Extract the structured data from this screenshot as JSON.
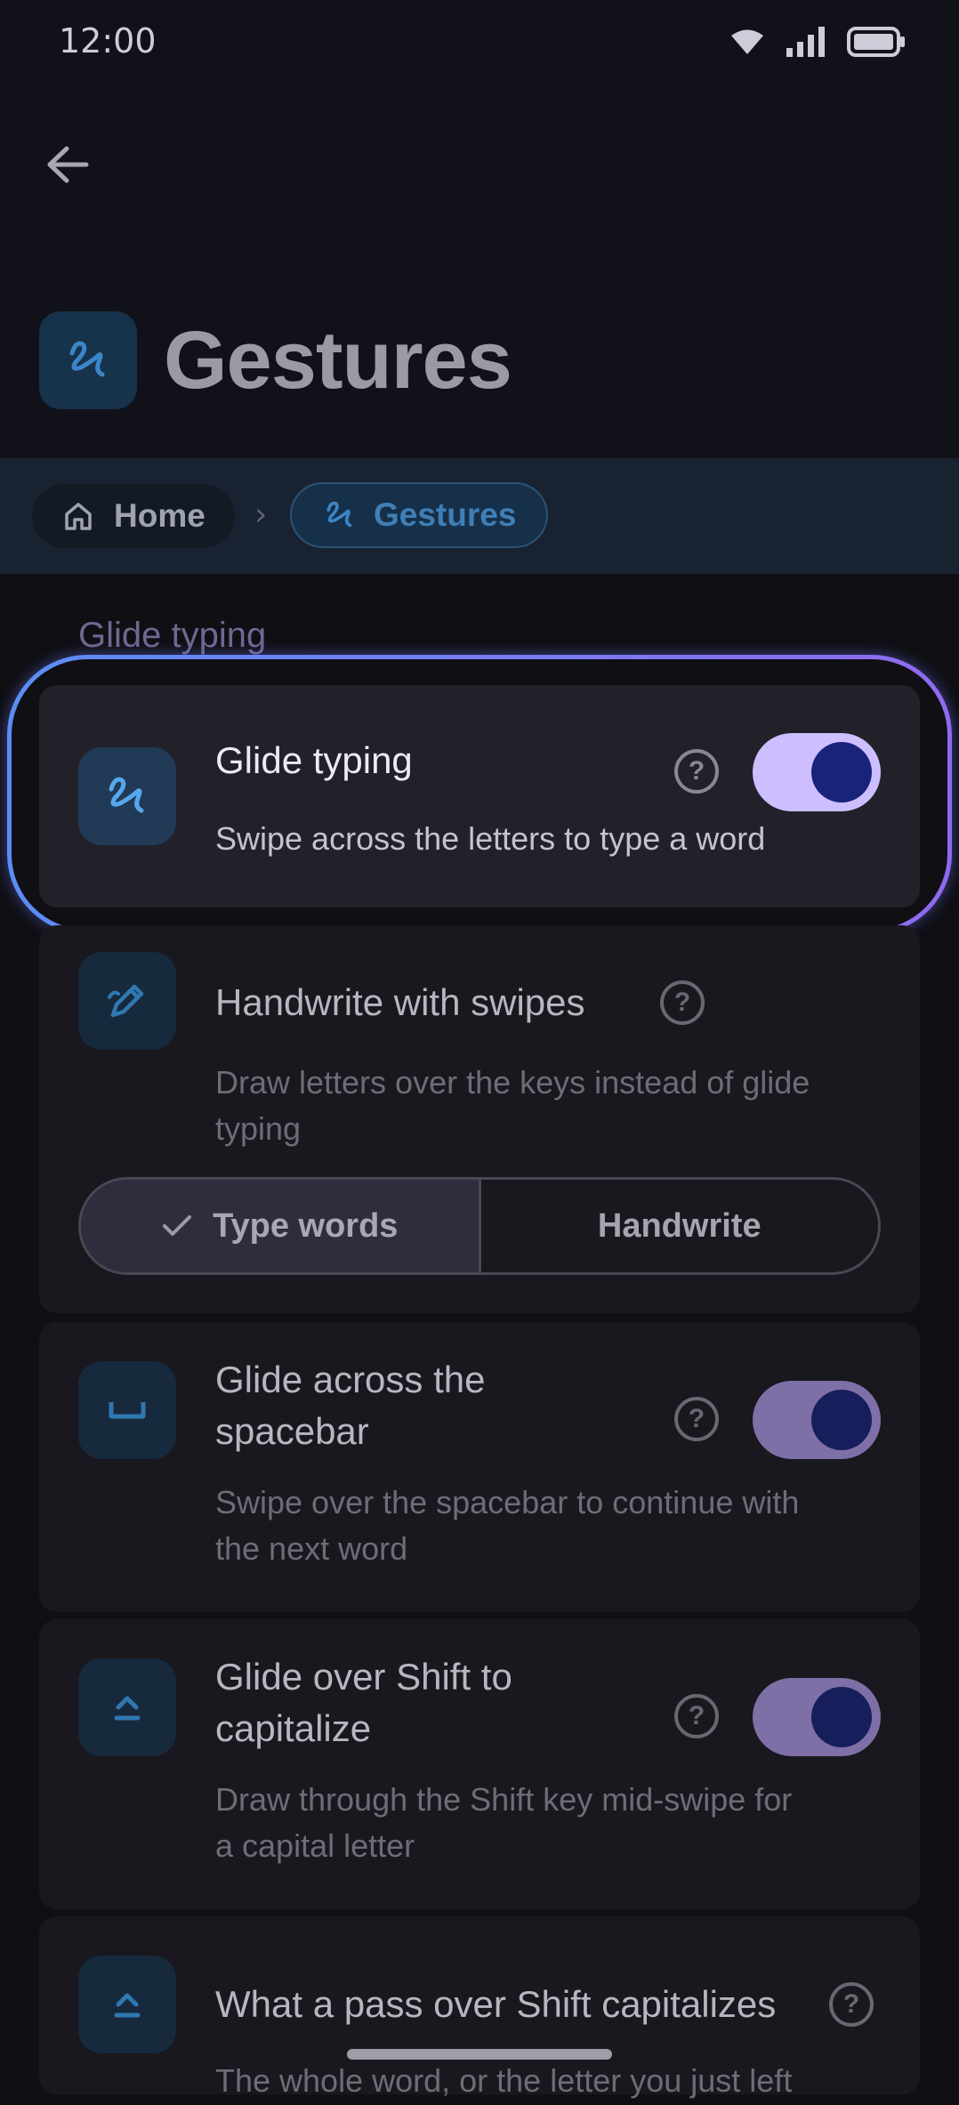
{
  "status": {
    "time": "12:00"
  },
  "page": {
    "title": "Gestures"
  },
  "breadcrumb": {
    "home": "Home",
    "separator": "›",
    "current": "Gestures"
  },
  "section": {
    "label": "Glide typing"
  },
  "settings": [
    {
      "title": "Glide typing",
      "desc": "Swipe across the letters to type a word",
      "toggle": true
    },
    {
      "title": "Handwrite with swipes",
      "desc_line1": "Draw letters over the keys instead of glide",
      "desc_line2": "typing"
    },
    {
      "title_line1": "Glide across the",
      "title_line2": "spacebar",
      "desc_line1": "Swipe over the spacebar to continue with",
      "desc_line2": "the next word",
      "toggle": true
    },
    {
      "title_line1": "Glide over Shift to",
      "title_line2": "capitalize",
      "desc_line1": "Draw through the Shift key mid-swipe for",
      "desc_line2": "a capital letter",
      "toggle": true
    },
    {
      "title": "What a pass over Shift capitalizes",
      "desc": "The whole word, or the letter you just left"
    }
  ],
  "segmented": {
    "option1": "Type words",
    "option2": "Handwrite",
    "selected": "Type words"
  },
  "help_glyph": "?",
  "colors": {
    "accent": "#3f7fb6",
    "toggle_on": "#cdbfff",
    "focus_ring_start": "#5b8df5",
    "focus_ring_end": "#8f6af0"
  }
}
